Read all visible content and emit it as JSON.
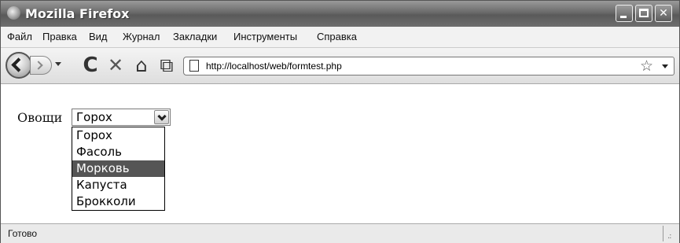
{
  "window": {
    "title": "Mozilla Firefox"
  },
  "menu": {
    "items": [
      {
        "label": "Файл"
      },
      {
        "label": "Правка"
      },
      {
        "label": "Вид"
      },
      {
        "label": "Журнал"
      },
      {
        "label": "Закладки"
      },
      {
        "label": "Инструменты"
      },
      {
        "label": "Справка"
      }
    ]
  },
  "toolbar": {
    "url": "http://localhost/web/formtest.php",
    "icons": [
      "back-icon",
      "forward-icon",
      "reload-icon",
      "stop-icon",
      "home-icon",
      "bookmark-add-icon",
      "page-icon",
      "star-icon"
    ]
  },
  "form": {
    "label": "Овощи",
    "selected_value": "Горох",
    "options": [
      {
        "label": "Горох"
      },
      {
        "label": "Фасоль"
      },
      {
        "label": "Морковь"
      },
      {
        "label": "Капуста"
      },
      {
        "label": "Брокколи"
      }
    ],
    "highlighted_option": "Морковь"
  },
  "status": {
    "text": "Готово"
  },
  "colors": {
    "highlight": "#555555",
    "titlebar": "#6a6a6a"
  }
}
